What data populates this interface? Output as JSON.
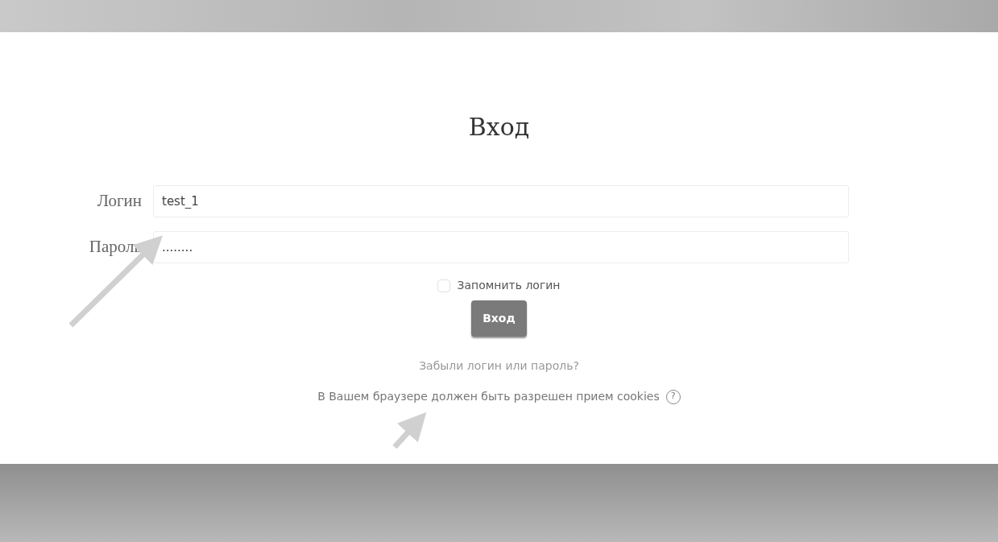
{
  "title": "Вход",
  "fields": [
    {
      "label": "Логин",
      "value": "test_1"
    },
    {
      "label": "Пароль",
      "value": "........"
    }
  ],
  "remember": {
    "label": "Запомнить логин",
    "checked": false
  },
  "submit": "Вход",
  "forgot_link": "Забыли логин или пароль?",
  "cookies_note": "В Вашем браузере должен быть разрешен прием cookies",
  "help_icon": "?"
}
